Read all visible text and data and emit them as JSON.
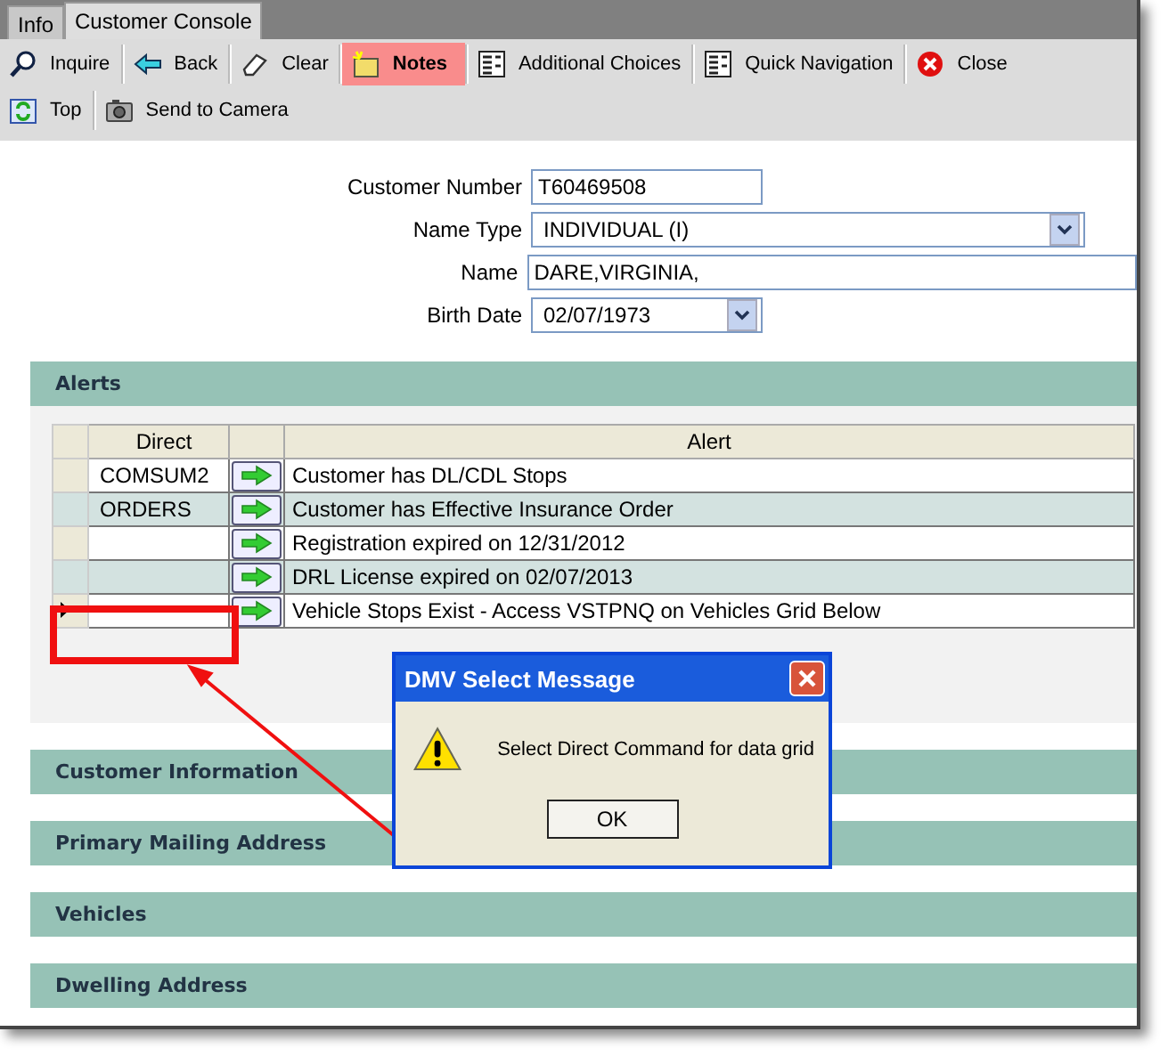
{
  "tabs": [
    {
      "label": "Info",
      "selected": false
    },
    {
      "label": "Customer Console",
      "selected": true
    }
  ],
  "toolbar": [
    [
      {
        "label": "Inquire",
        "highlighted": false
      },
      {
        "label": "Back",
        "highlighted": false
      },
      {
        "label": "Clear",
        "highlighted": false
      },
      {
        "label": "Notes",
        "highlighted": true
      },
      {
        "label": "Additional Choices",
        "highlighted": false
      },
      {
        "label": "Quick Navigation",
        "highlighted": false
      },
      {
        "label": "Close",
        "highlighted": false
      }
    ],
    [
      {
        "label": "Top",
        "highlighted": false
      },
      {
        "label": "Send to Camera",
        "highlighted": false
      }
    ]
  ],
  "form": [
    {
      "label": "Customer Number",
      "value": "T60469508",
      "kind": "text"
    },
    {
      "label": "Name Type",
      "value": "INDIVIDUAL (I)",
      "kind": "select"
    },
    {
      "label": "Name",
      "value": "DARE,VIRGINIA,",
      "kind": "text"
    },
    {
      "label": "Birth Date",
      "value": "02/07/1973",
      "kind": "select"
    }
  ],
  "alerts": {
    "title": "Alerts",
    "columns": [
      "Direct",
      "Alert"
    ],
    "rows": [
      {
        "direct": "COMSUM2",
        "alert": "Customer has DL/CDL Stops",
        "current": false
      },
      {
        "direct": "ORDERS",
        "alert": "Customer has Effective Insurance Order",
        "current": false
      },
      {
        "direct": "",
        "alert": "Registration expired on 12/31/2012",
        "current": false
      },
      {
        "direct": "",
        "alert": "DRL License expired on 02/07/2013",
        "current": false
      },
      {
        "direct": "",
        "alert": "Vehicle Stops Exist - Access VSTPNQ on Vehicles Grid Below",
        "current": true
      }
    ]
  },
  "sections": [
    "Customer Information",
    "Primary Mailing Address",
    "Vehicles",
    "Dwelling Address"
  ],
  "dialog": {
    "title": "DMV Select Message",
    "message": "Select Direct Command for data grid",
    "button": "OK"
  }
}
